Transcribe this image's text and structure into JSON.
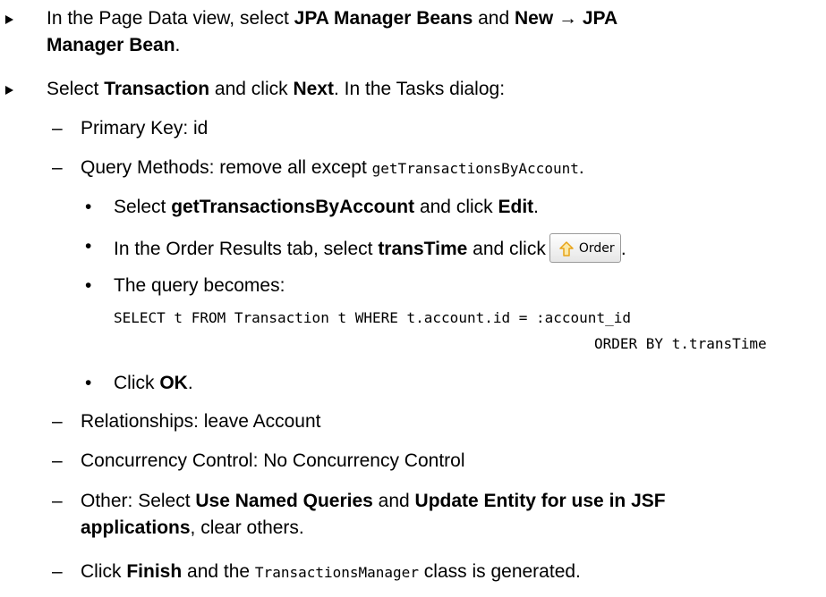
{
  "steps": [
    {
      "line1": {
        "t1": "In the Page Data view, select ",
        "b1": "JPA Manager Beans",
        "t2": " and ",
        "b2": "New",
        "arrow": " → ",
        "b3": "JPA"
      },
      "line2": {
        "b1": "Manager Bean",
        "t1": "."
      }
    },
    {
      "line1": {
        "t1": "Select ",
        "b1": "Transaction",
        "t2": " and click ",
        "b2": "Next",
        "t3": ". In the Tasks dialog:"
      }
    }
  ],
  "dash_items": {
    "primary_key": "Primary Key: id",
    "query_methods": {
      "t1": "Query Methods: remove all except ",
      "code": "getTransactionsByAccount",
      "t2": "."
    },
    "relationships": "Relationships: leave Account",
    "concurrency": "Concurrency Control: No Concurrency Control",
    "other": {
      "t1": "Other: Select ",
      "b1": "Use Named Queries",
      "t2": " and ",
      "b2": "Update Entity for use in JSF",
      "line2_b": "applications",
      "line2_t": ", clear others."
    },
    "finish": {
      "t1": "Click ",
      "b1": "Finish",
      "t2": " and the ",
      "code": "TransactionsManager",
      "t3": " class is generated."
    }
  },
  "bullets": {
    "select_edit": {
      "t1": "Select ",
      "b1": "getTransactionsByAccount",
      "t2": " and click ",
      "b2": "Edit",
      "t3": "."
    },
    "order_results": {
      "t1": "In the Order Results tab, select ",
      "b1": "transTime",
      "t2": " and click",
      "after": "."
    },
    "query_becomes": "The query becomes:",
    "click_ok": {
      "t1": "Click ",
      "b1": "OK",
      "t2": "."
    }
  },
  "order_button": {
    "label": "Order",
    "icon": "up-arrow-icon",
    "arrow_color": "#e8a317"
  },
  "query_code": {
    "line1": "SELECT t FROM Transaction t WHERE t.account.id = :account_id",
    "line2": "ORDER BY t.transTime"
  },
  "glyphs": {
    "step_marker": "►",
    "dash": "–",
    "bullet": "•"
  }
}
